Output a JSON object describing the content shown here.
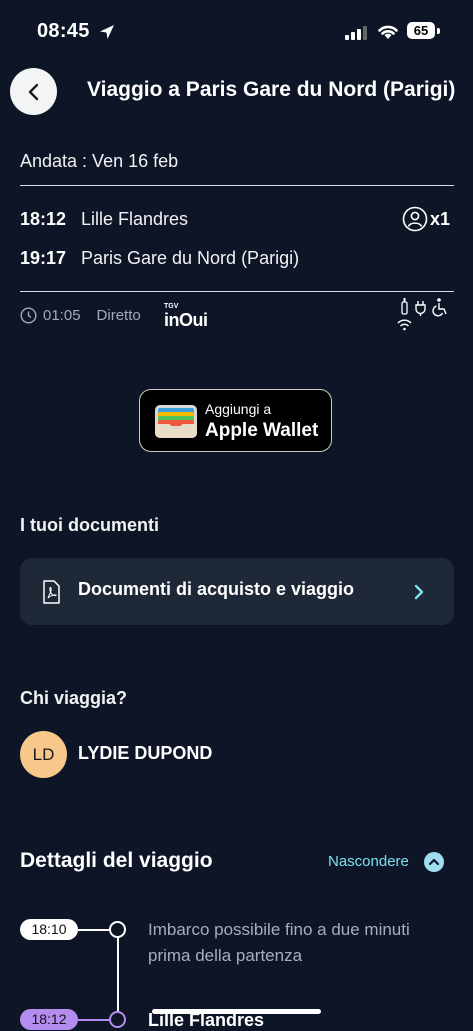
{
  "status_bar": {
    "time": "08:45",
    "battery": "65"
  },
  "header": {
    "title": "Viaggio a Paris Gare du Nord (Parigi)"
  },
  "trip": {
    "outbound_label": "Andata : Ven 16 feb",
    "departure": {
      "time": "18:12",
      "station": "Lille Flandres"
    },
    "arrival": {
      "time": "19:17",
      "station": "Paris Gare du Nord (Parigi)"
    },
    "passengers": "x1",
    "duration": "01:05",
    "type": "Diretto",
    "brand_small": "TGV",
    "brand": "inOui"
  },
  "wallet": {
    "line1": "Aggiungi a",
    "line2": "Apple Wallet"
  },
  "documents": {
    "section_title": "I tuoi documenti",
    "item_label": "Documenti di acquisto e viaggio"
  },
  "travelers": {
    "section_title": "Chi viaggia?",
    "initials": "LD",
    "name": "LYDIE DUPOND"
  },
  "details": {
    "title": "Dettagli del viaggio",
    "hide_label": "Nascondere",
    "timeline": [
      {
        "time": "18:10",
        "text": "Imbarco possibile fino a due minuti prima della partenza"
      },
      {
        "time": "18:12",
        "text": "Lille Flandres"
      }
    ]
  },
  "colors": {
    "background": "#0d1527",
    "card": "#1f2837",
    "accent": "#7ee0ee",
    "avatar": "#f7c88a",
    "timeline_active": "#b48cf0"
  }
}
